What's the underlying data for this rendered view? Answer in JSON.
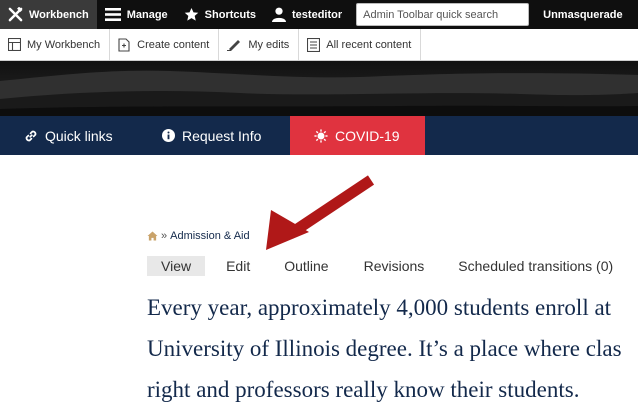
{
  "admin_toolbar": {
    "workbench": "Workbench",
    "manage": "Manage",
    "shortcuts": "Shortcuts",
    "user": "testeditor",
    "search_placeholder": "Admin Toolbar quick search",
    "unmasquerade": "Unmasquerade"
  },
  "shortcut_tray": {
    "items": [
      "My Workbench",
      "Create content",
      "My edits",
      "All recent content"
    ]
  },
  "quick_nav": {
    "quick_links": "Quick links",
    "request_info": "Request Info",
    "covid": "COVID-19"
  },
  "breadcrumb": {
    "separator": "»",
    "current": "Admission & Aid"
  },
  "tabs": [
    "View",
    "Edit",
    "Outline",
    "Revisions",
    "Scheduled transitions (0)"
  ],
  "lead_text": [
    "Every year, approximately 4,000 students enroll at",
    "University of Illinois degree. It’s a place where clas",
    "right and professors really know their students."
  ],
  "colors": {
    "navy": "#13294b",
    "covid_red": "#e0333f",
    "arrow_red": "#b01818"
  }
}
